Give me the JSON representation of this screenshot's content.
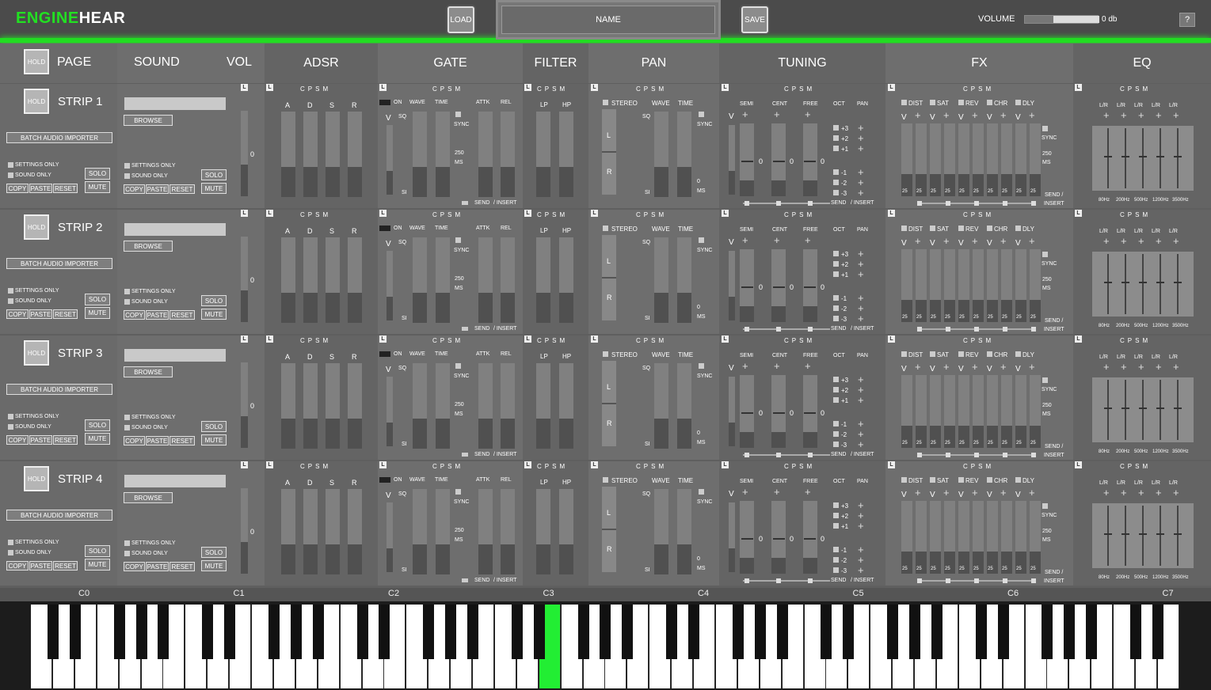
{
  "app": {
    "logo_a": "ENGINE",
    "logo_b": "HEAR"
  },
  "toolbar": {
    "load": "LOAD",
    "name": "NAME",
    "save": "SAVE",
    "volume_label": "VOLUME",
    "volume_value": "0 db",
    "help": "?"
  },
  "headers": {
    "hold": "HOLD",
    "page": "PAGE",
    "sound": "SOUND",
    "vol": "VOL",
    "adsr": "ADSR",
    "gate": "GATE",
    "filter": "FILTER",
    "pan": "PAN",
    "tuning": "TUNING",
    "fx": "FX",
    "eq": "EQ"
  },
  "strip_labels": {
    "hold": "HOLD",
    "batch": "BATCH AUDIO IMPORTER",
    "settings_only": "SETTINGS ONLY",
    "sound_only": "SOUND ONLY",
    "copy": "COPY",
    "paste": "PASTE",
    "reset": "RESET",
    "solo": "SOLO",
    "mute": "MUTE",
    "browse": "BROWSE",
    "vol_val": "0",
    "L": "L",
    "cpsm": "CPSM",
    "adsr": [
      "A",
      "D",
      "S",
      "R"
    ],
    "gate": {
      "on": "ON",
      "wave": "WAVE",
      "time": "TIME",
      "attk": "ATTK",
      "rel": "REL",
      "v": "V",
      "sq": "SQ",
      "si": "SI",
      "sync": "SYNC",
      "ms_val": "250",
      "ms": "MS",
      "send": "SEND",
      "insert": "/ INSERT"
    },
    "filter": {
      "lp": "LP",
      "hp": "HP"
    },
    "pan": {
      "stereo": "STEREO",
      "wave": "WAVE",
      "time": "TIME",
      "l": "L",
      "r": "R",
      "sq": "SQ",
      "si": "SI",
      "sync": "SYNC",
      "zero": "0",
      "ms": "MS"
    },
    "tuning": {
      "semi": "SEMI",
      "cent": "CENT",
      "free": "FREE",
      "oct": "OCT",
      "pan": "PAN",
      "v": "V",
      "zero": "0",
      "octs": [
        "+3",
        "+2",
        "+1",
        "-1",
        "-2",
        "-3"
      ],
      "send": "SEND",
      "insert": "/ INSERT"
    },
    "fx": {
      "types": [
        "DIST",
        "SAT",
        "REV",
        "CHR",
        "DLY"
      ],
      "v": "V",
      "val": "25",
      "sync": "SYNC",
      "ms_val": "250",
      "ms": "MS",
      "send": "SEND /",
      "insert": "INSERT"
    },
    "eq": {
      "lr": "L/R",
      "freqs": [
        "80Hz",
        "200Hz",
        "500Hz",
        "1200Hz",
        "3500Hz"
      ]
    }
  },
  "strips": [
    {
      "name": "STRIP 1"
    },
    {
      "name": "STRIP 2"
    },
    {
      "name": "STRIP 3"
    },
    {
      "name": "STRIP 4"
    }
  ],
  "keyboard": {
    "notes": [
      "C0",
      "C1",
      "C2",
      "C3",
      "C4",
      "C5",
      "C6",
      "C7"
    ],
    "active_note": "C3"
  }
}
